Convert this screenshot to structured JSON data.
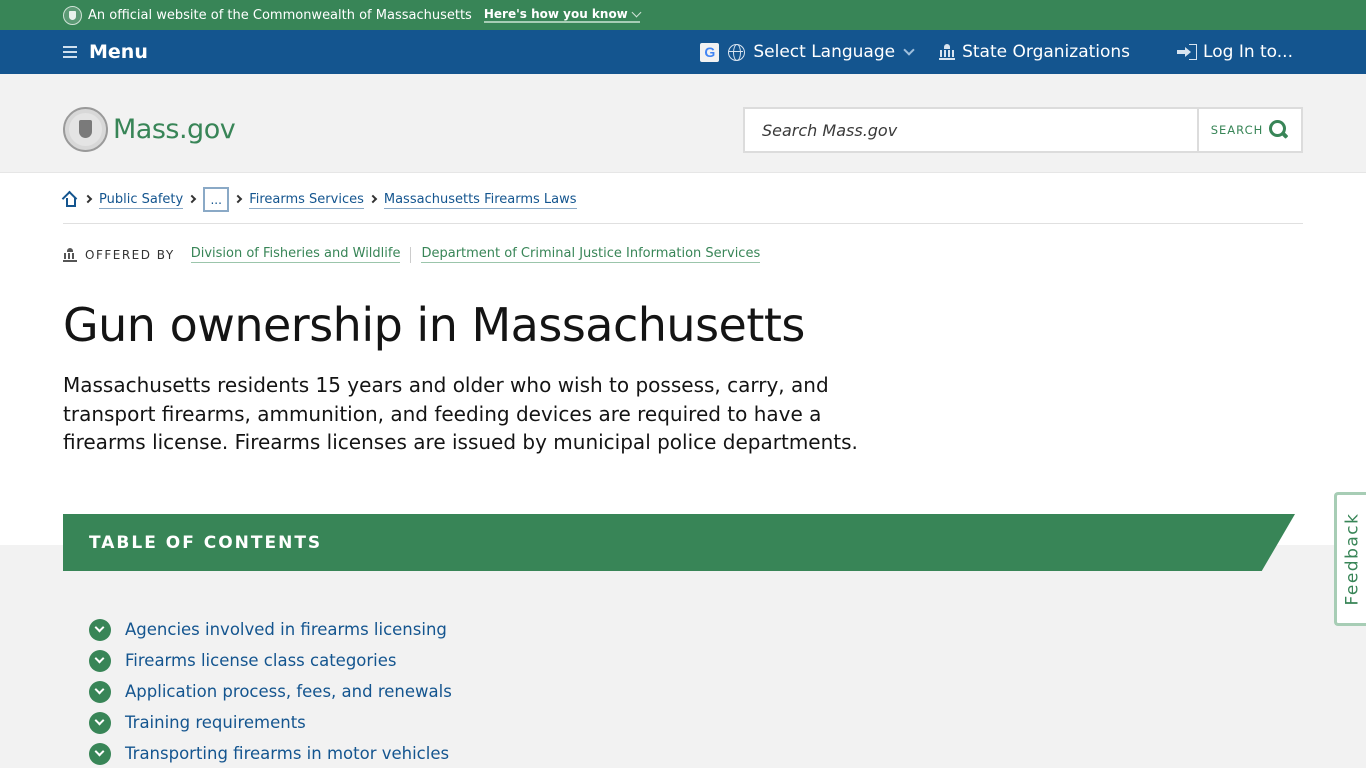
{
  "official_banner": {
    "text": "An official website of the Commonwealth of Massachusetts",
    "how_you_know": "Here's how you know"
  },
  "navbar": {
    "menu_label": "Menu",
    "google_glyph": "G",
    "language_label": "Select Language",
    "state_orgs_label": "State Organizations",
    "login_label": "Log In to..."
  },
  "header": {
    "brand": "Mass.gov",
    "search_placeholder": "Search Mass.gov",
    "search_button": "SEARCH"
  },
  "breadcrumb": {
    "items": [
      "Public Safety",
      "...",
      "Firearms Services",
      "Massachusetts Firearms Laws"
    ]
  },
  "offered_by": {
    "label": "OFFERED BY",
    "orgs": [
      "Division of Fisheries and Wildlife",
      "Department of Criminal Justice Information Services"
    ]
  },
  "page": {
    "title": "Gun ownership in Massachusetts",
    "lede": "Massachusetts residents 15 years and older who wish to possess, carry, and transport firearms, ammunition, and feeding devices are required to have a firearms license. Firearms licenses are issued by municipal police departments."
  },
  "toc": {
    "heading": "TABLE OF CONTENTS",
    "items": [
      "Agencies involved in firearms licensing",
      "Firearms license class categories",
      "Application process, fees, and renewals",
      "Training requirements",
      "Transporting firearms in motor vehicles"
    ]
  },
  "feedback": {
    "label": "Feedback"
  },
  "colors": {
    "brand_green": "#388557",
    "nav_blue": "#14558f",
    "header_gray": "#f2f2f2"
  }
}
